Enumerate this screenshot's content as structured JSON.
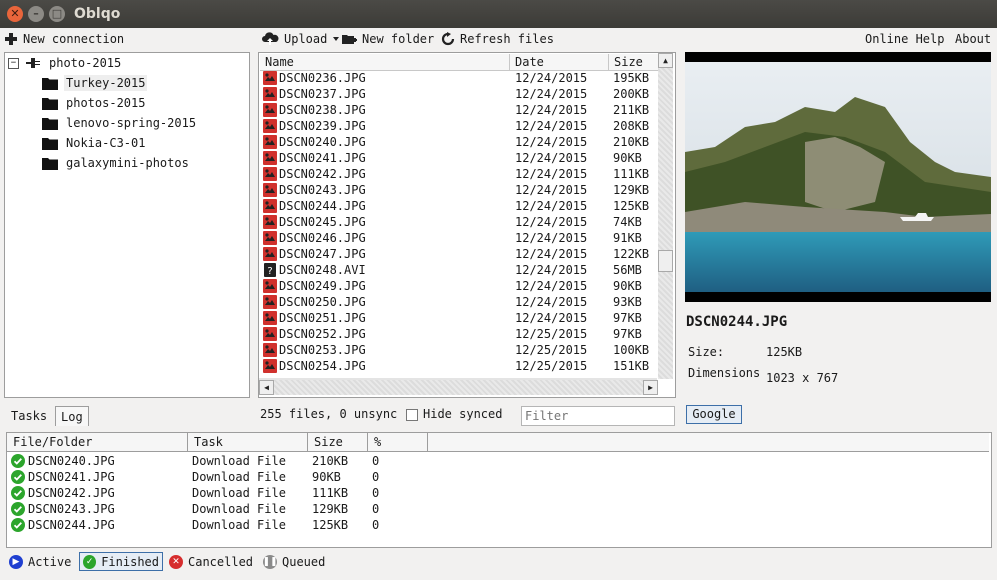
{
  "window": {
    "title": "Oblqo"
  },
  "toolbar": {
    "new_connection": "New connection",
    "upload": "Upload",
    "new_folder": "New folder",
    "refresh": "Refresh files",
    "help": "Online Help",
    "about": "About"
  },
  "tree": {
    "root": "photo-2015",
    "items": [
      "Turkey-2015",
      "photos-2015",
      "lenovo-spring-2015",
      "Nokia-C3-01",
      "galaxymini-photos"
    ],
    "selected_index": 0
  },
  "files": {
    "columns": [
      "Name",
      "Date",
      "Size"
    ],
    "rows": [
      {
        "name": "DSCN0236.JPG",
        "date": "12/24/2015",
        "size": "195KB",
        "icon": "image-file-icon"
      },
      {
        "name": "DSCN0237.JPG",
        "date": "12/24/2015",
        "size": "200KB",
        "icon": "image-file-icon"
      },
      {
        "name": "DSCN0238.JPG",
        "date": "12/24/2015",
        "size": "211KB",
        "icon": "image-file-icon"
      },
      {
        "name": "DSCN0239.JPG",
        "date": "12/24/2015",
        "size": "208KB",
        "icon": "image-file-icon"
      },
      {
        "name": "DSCN0240.JPG",
        "date": "12/24/2015",
        "size": "210KB",
        "icon": "image-file-icon"
      },
      {
        "name": "DSCN0241.JPG",
        "date": "12/24/2015",
        "size": "90KB",
        "icon": "image-file-icon"
      },
      {
        "name": "DSCN0242.JPG",
        "date": "12/24/2015",
        "size": "111KB",
        "icon": "image-file-icon"
      },
      {
        "name": "DSCN0243.JPG",
        "date": "12/24/2015",
        "size": "129KB",
        "icon": "image-file-icon"
      },
      {
        "name": "DSCN0244.JPG",
        "date": "12/24/2015",
        "size": "125KB",
        "icon": "image-file-icon"
      },
      {
        "name": "DSCN0245.JPG",
        "date": "12/24/2015",
        "size": "74KB",
        "icon": "image-file-icon"
      },
      {
        "name": "DSCN0246.JPG",
        "date": "12/24/2015",
        "size": "91KB",
        "icon": "image-file-icon"
      },
      {
        "name": "DSCN0247.JPG",
        "date": "12/24/2015",
        "size": "122KB",
        "icon": "image-file-icon"
      },
      {
        "name": "DSCN0248.AVI",
        "date": "12/24/2015",
        "size": "56MB",
        "icon": "unknown-file-icon"
      },
      {
        "name": "DSCN0249.JPG",
        "date": "12/24/2015",
        "size": "90KB",
        "icon": "image-file-icon"
      },
      {
        "name": "DSCN0250.JPG",
        "date": "12/24/2015",
        "size": "93KB",
        "icon": "image-file-icon"
      },
      {
        "name": "DSCN0251.JPG",
        "date": "12/24/2015",
        "size": "97KB",
        "icon": "image-file-icon"
      },
      {
        "name": "DSCN0252.JPG",
        "date": "12/25/2015",
        "size": "97KB",
        "icon": "image-file-icon"
      },
      {
        "name": "DSCN0253.JPG",
        "date": "12/25/2015",
        "size": "100KB",
        "icon": "image-file-icon"
      },
      {
        "name": "DSCN0254.JPG",
        "date": "12/25/2015",
        "size": "151KB",
        "icon": "image-file-icon"
      }
    ]
  },
  "preview": {
    "filename": "DSCN0244.JPG",
    "size_label": "Size:",
    "size_value": "125KB",
    "dimensions_label": "Dimensions",
    "dimensions_value": "1023 x 767",
    "google_button": "Google"
  },
  "status": {
    "summary": "255 files, 0 unsync",
    "hide_synced": "Hide synced",
    "filter_placeholder": "Filter"
  },
  "tabs": {
    "tasks": "Tasks",
    "log": "Log"
  },
  "tasks": {
    "columns": [
      "File/Folder",
      "Task",
      "Size",
      "%"
    ],
    "rows": [
      {
        "file": "DSCN0240.JPG",
        "task": "Download File",
        "size": "210KB",
        "pct": "0"
      },
      {
        "file": "DSCN0241.JPG",
        "task": "Download File",
        "size": "90KB",
        "pct": "0"
      },
      {
        "file": "DSCN0242.JPG",
        "task": "Download File",
        "size": "111KB",
        "pct": "0"
      },
      {
        "file": "DSCN0243.JPG",
        "task": "Download File",
        "size": "129KB",
        "pct": "0"
      },
      {
        "file": "DSCN0244.JPG",
        "task": "Download File",
        "size": "125KB",
        "pct": "0"
      }
    ]
  },
  "task_filters": {
    "active": "Active",
    "finished": "Finished",
    "cancelled": "Cancelled",
    "queued": "Queued",
    "selected": "finished"
  },
  "colors": {
    "titlebar": "#3c3b37",
    "image_icon": "#d0312d",
    "finished_icon": "#2ca52c",
    "active_icon": "#1f3fd0",
    "cancelled_icon": "#d62d2d",
    "queued_icon": "#8a8a8a"
  }
}
